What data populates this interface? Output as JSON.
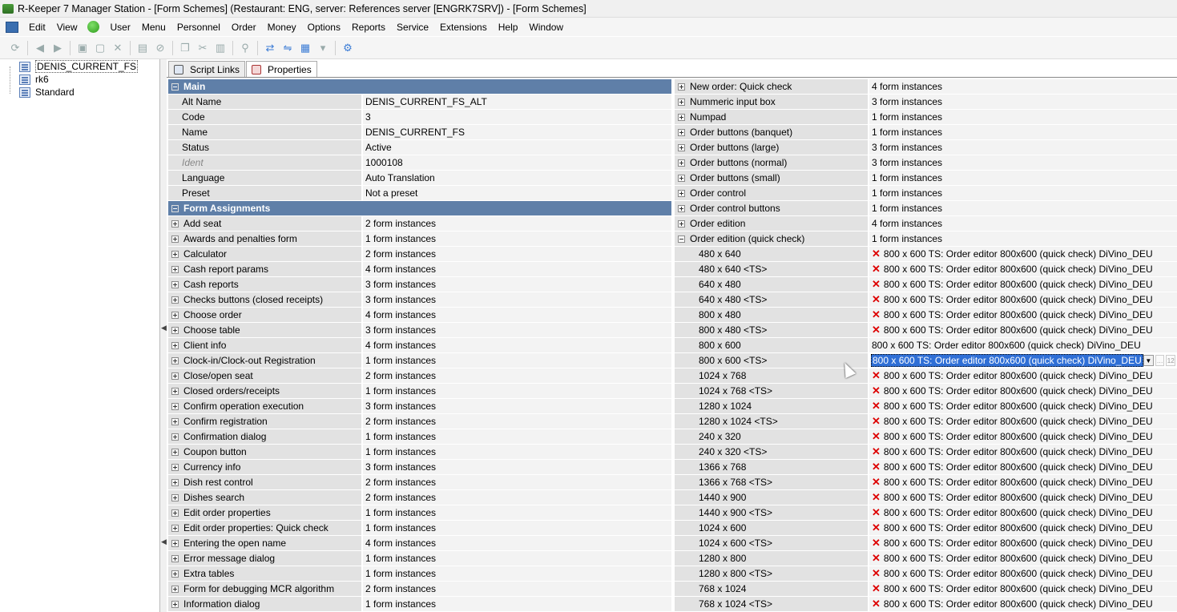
{
  "window": {
    "title": "R-Keeper 7 Manager Station - [Form Schemes] (Restaurant: ENG, server: References server [ENGRK7SRV]) - [Form Schemes]"
  },
  "menu": [
    "Edit",
    "View",
    "User",
    "Menu",
    "Personnel",
    "Order",
    "Money",
    "Options",
    "Reports",
    "Service",
    "Extensions",
    "Help",
    "Window"
  ],
  "tree": [
    "DENIS_CURRENT_FS",
    "rk6",
    "Standard"
  ],
  "tabs": [
    "Script Links",
    "Properties"
  ],
  "left": {
    "main_header": "Main",
    "main": [
      {
        "label": "Alt Name",
        "value": "DENIS_CURRENT_FS_ALT"
      },
      {
        "label": "Code",
        "value": "3"
      },
      {
        "label": "Name",
        "value": "DENIS_CURRENT_FS"
      },
      {
        "label": "Status",
        "value": "Active"
      },
      {
        "label": "Ident",
        "value": "1000108"
      },
      {
        "label": "Language",
        "value": "Auto Translation"
      },
      {
        "label": "Preset",
        "value": "Not a preset"
      }
    ],
    "assign_header": "Form Assignments",
    "assignments": [
      {
        "label": "Add seat",
        "value": "2 form instances"
      },
      {
        "label": "Awards and penalties form",
        "value": "1 form instances"
      },
      {
        "label": "Calculator",
        "value": "2 form instances"
      },
      {
        "label": "Cash report params",
        "value": "4 form instances"
      },
      {
        "label": "Cash reports",
        "value": "3 form instances"
      },
      {
        "label": "Checks buttons (closed receipts)",
        "value": "3 form instances"
      },
      {
        "label": "Choose order",
        "value": "4 form instances"
      },
      {
        "label": "Choose table",
        "value": "3 form instances"
      },
      {
        "label": "Client info",
        "value": "4 form instances"
      },
      {
        "label": "Clock-in/Clock-out Registration",
        "value": "1 form instances"
      },
      {
        "label": "Close/open seat",
        "value": "2 form instances"
      },
      {
        "label": "Closed orders/receipts",
        "value": "1 form instances"
      },
      {
        "label": "Confirm operation execution",
        "value": "3 form instances"
      },
      {
        "label": "Confirm registration",
        "value": "2 form instances"
      },
      {
        "label": "Confirmation dialog",
        "value": "1 form instances"
      },
      {
        "label": "Coupon button",
        "value": "1 form instances"
      },
      {
        "label": "Currency info",
        "value": "3 form instances"
      },
      {
        "label": "Dish rest control",
        "value": "2 form instances"
      },
      {
        "label": "Dishes search",
        "value": "2 form instances"
      },
      {
        "label": "Edit order properties",
        "value": "1 form instances"
      },
      {
        "label": "Edit order properties: Quick check",
        "value": "1 form instances"
      },
      {
        "label": "Entering the open name",
        "value": "4 form instances"
      },
      {
        "label": "Error message dialog",
        "value": "1 form instances"
      },
      {
        "label": "Extra tables",
        "value": "1 form instances"
      },
      {
        "label": "Form for debugging MCR algorithm",
        "value": "2 form instances"
      },
      {
        "label": "Information dialog",
        "value": "1 form instances"
      }
    ]
  },
  "right": {
    "groups": [
      {
        "label": "New order: Quick check",
        "value": "4 form instances"
      },
      {
        "label": "Nummeric input box",
        "value": "3 form instances"
      },
      {
        "label": "Numpad",
        "value": "1 form instances"
      },
      {
        "label": "Order buttons (banquet)",
        "value": "1 form instances"
      },
      {
        "label": "Order buttons (large)",
        "value": "3 form instances"
      },
      {
        "label": "Order buttons (normal)",
        "value": "3 form instances"
      },
      {
        "label": "Order buttons (small)",
        "value": "1 form instances"
      },
      {
        "label": "Order control",
        "value": "1 form instances"
      },
      {
        "label": "Order control buttons",
        "value": "1 form instances"
      },
      {
        "label": "Order edition",
        "value": "4 form instances"
      }
    ],
    "expanded": {
      "label": "Order edition (quick check)",
      "value": "1 form instances"
    },
    "form_value": "800 x 600 TS: Order editor 800x600 (quick check) DiVino_DEU",
    "resolutions": [
      "480 x 640",
      "480 x 640 <TS>",
      "640 x 480",
      "640 x 480 <TS>",
      "800 x 480",
      "800 x 480 <TS>",
      "800 x 600",
      "800 x 600 <TS>",
      "1024 x 768",
      "1024 x 768 <TS>",
      "1280 x 1024",
      "1280 x 1024 <TS>",
      "240 x 320",
      "240 x 320 <TS>",
      "1366 x 768",
      "1366 x 768 <TS>",
      "1440 x 900",
      "1440 x 900 <TS>",
      "1024 x 600",
      "1024 x 600 <TS>",
      "1280 x 800",
      "1280 x 800 <TS>",
      "768 x 1024",
      "768 x 1024 <TS>"
    ],
    "plain_index": 6,
    "selected_index": 7,
    "editor_counter": "12"
  }
}
